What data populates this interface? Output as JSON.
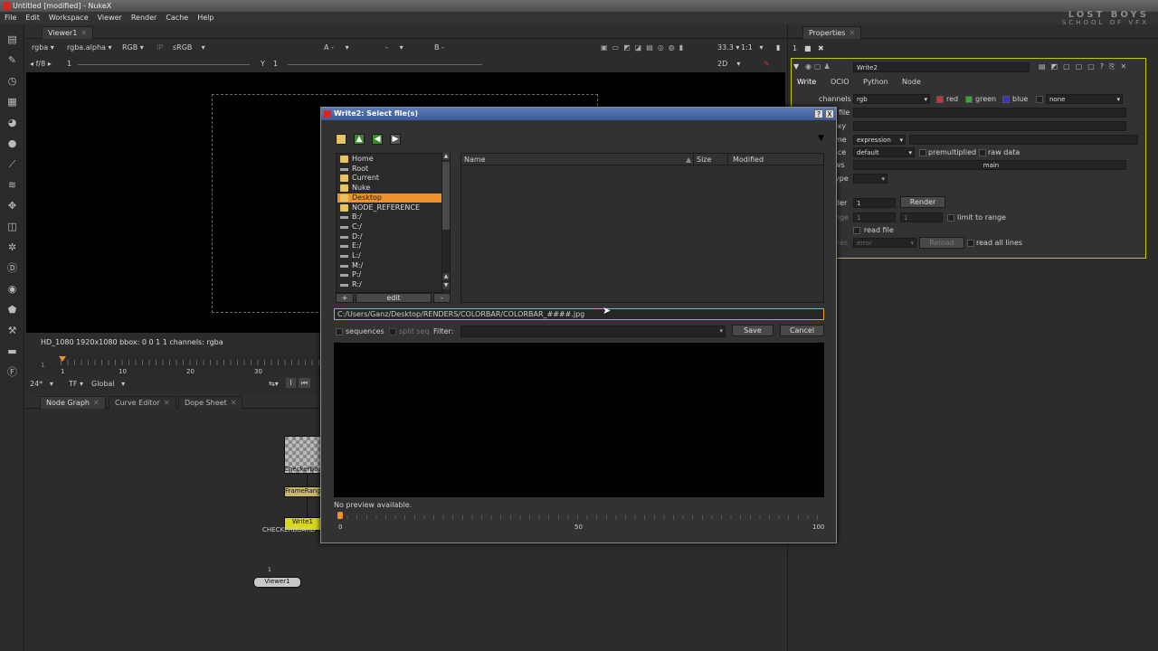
{
  "window": {
    "title": "Untitled [modified] - NukeX"
  },
  "menu": [
    "File",
    "Edit",
    "Workspace",
    "Viewer",
    "Render",
    "Cache",
    "Help"
  ],
  "brand": {
    "line1": "LOST BOYS",
    "line2": "SCHOOL OF VFX"
  },
  "viewer": {
    "tab": "Viewer1",
    "channels": "rgba",
    "alpha": "rgba.alpha",
    "colorspace": "RGB",
    "ip": "IP",
    "lut": "sRGB",
    "a_label": "A",
    "a_value": "-",
    "mid_value": "-",
    "b_label": "B",
    "b_value": "-",
    "zoom": "33.3",
    "ratio": "1:1",
    "mode": "2D",
    "fstop": "f/8",
    "gain": "1",
    "gamma_label": "Y",
    "gamma": "1",
    "info": "HD_1080 1920x1080  bbox: 0 0 1 1 channels: rgba",
    "frame_start": "1",
    "ticks": [
      "1",
      "10",
      "20",
      "30"
    ],
    "current_frame": "1",
    "fps": "24*",
    "tf": "TF",
    "global": "Global"
  },
  "bottom_tabs": [
    "Node Graph",
    "Curve Editor",
    "Dope Sheet"
  ],
  "nodes": {
    "checker": "CheckerBoa",
    "framerange": "FrameRang",
    "write": "Write1",
    "write_sub": "CHECKERBOARD",
    "viewer": "Viewer1",
    "viewer_in": "1"
  },
  "properties": {
    "tab": "Properties",
    "node_name": "Write2",
    "tabs": [
      "Write",
      "OCIO",
      "Python",
      "Node"
    ],
    "channels_label": "channels",
    "channels_value": "rgb",
    "red": "red",
    "green": "green",
    "blue": "blue",
    "none": "none",
    "file_label": "file",
    "proxy_label": "oxy",
    "frame_label": "me",
    "frame_mode": "expression",
    "colorspace_label": "ace",
    "colorspace_value": "default",
    "premultiplied": "premultiplied",
    "raw_data": "raw data",
    "views_label": "ws",
    "views_value": "main",
    "type_label": "ype",
    "render_label": "der",
    "render_value": "1",
    "render_btn": "Render",
    "range_label": "nge",
    "range_a": "1",
    "range_b": "1",
    "limit": "limit to range",
    "read_file": "read file",
    "missing_label": "nes",
    "error": "error",
    "reload": "Reload",
    "read_all_lines": "read all lines"
  },
  "dialog": {
    "title": "Write2: Select file(s)",
    "help_btn": "?",
    "close_btn": "X",
    "favorites": [
      {
        "label": "Home",
        "type": "folder"
      },
      {
        "label": "Root",
        "type": "drive"
      },
      {
        "label": "Current",
        "type": "folder"
      },
      {
        "label": "Nuke",
        "type": "folder"
      },
      {
        "label": "Desktop",
        "type": "folder",
        "selected": true
      },
      {
        "label": "NODE_REFERENCE",
        "type": "folder"
      },
      {
        "label": "B:/",
        "type": "drive"
      },
      {
        "label": "C:/",
        "type": "drive"
      },
      {
        "label": "D:/",
        "type": "drive"
      },
      {
        "label": "E:/",
        "type": "drive"
      },
      {
        "label": "L:/",
        "type": "drive"
      },
      {
        "label": "M:/",
        "type": "drive"
      },
      {
        "label": "P:/",
        "type": "drive"
      },
      {
        "label": "R:/",
        "type": "drive"
      }
    ],
    "add": "+",
    "edit": "edit",
    "remove": "-",
    "columns": {
      "name": "Name",
      "size": "Size",
      "modified": "Modified"
    },
    "path": "C:/Users/Ganz/Desktop/RENDERS/COLORBAR/COLORBAR_####.jpg",
    "sequences": "sequences",
    "split_seq": "split seq",
    "filter_label": "Filter:",
    "save": "Save",
    "cancel": "Cancel",
    "no_preview": "No preview available.",
    "slider_ticks": [
      "0",
      "50",
      "100"
    ]
  }
}
